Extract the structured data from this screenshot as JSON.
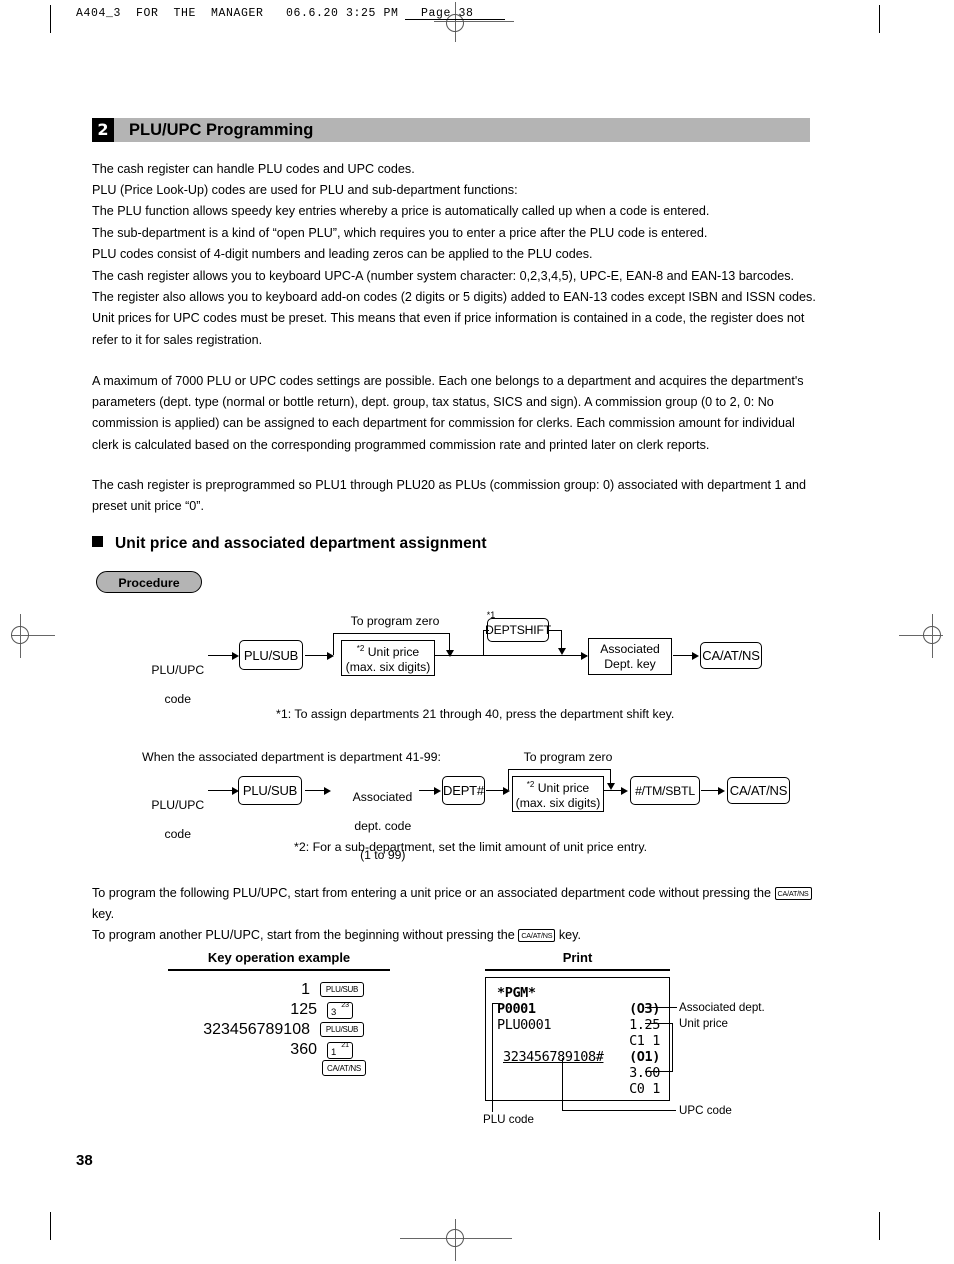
{
  "page": {
    "running_header": "A404_3  FOR  THE  MANAGER   06.6.20 3:25 PM   Page 38",
    "page_number": "38"
  },
  "section": {
    "number": "2",
    "title": "PLU/UPC Programming"
  },
  "paragraphs": {
    "p1_l1": "The cash register can handle PLU codes and UPC codes.",
    "p1_l2": "PLU (Price Look-Up) codes are used for PLU and sub-department functions:",
    "p1_l3": "The PLU function allows speedy key entries whereby a price is automatically called up when a code is entered.",
    "p1_l4": "The sub-department is a kind of “open PLU”, which requires you to enter a price after the PLU code is entered.",
    "p1_l5": "PLU codes consist of 4-digit numbers and leading zeros can be applied to the PLU codes.",
    "p2_a": "The cash register allows you to keyboard UPC-A (number system character: 0,2,3,4,5), UPC-E, EAN-8 and EAN-13 barcodes. The register also allows you to keyboard add-on codes (2 digits or 5 digits) added to EAN-13 codes except ISBN and ISSN codes.",
    "p2_b": "Unit prices for UPC codes must be preset.  This means that even if price information is contained in a code, the register does not refer to it for sales registration.",
    "p3": "A maximum of 7000 PLU or UPC codes settings are possible.  Each one belongs to a department and acquires the department's parameters (dept. type (normal or bottle return), dept. group, tax status, SICS and sign).  A commission group (0 to 2, 0: No commission is applied) can be assigned to each department for commission for clerks.  Each commission amount for individual clerk is calculated based on the corresponding programmed commission rate and printed later on clerk reports.",
    "p4": "The cash register is preprogrammed so PLU1 through PLU20 as PLUs (commission group: 0) associated with department 1 and preset unit price “0”."
  },
  "subsection": {
    "heading": "Unit price and associated department assignment",
    "procedure_label": "Procedure"
  },
  "diagram1": {
    "start_line1": "PLU/UPC",
    "start_line2": "code",
    "key_plusub": "PLU/SUB",
    "to_program_zero": "To program zero",
    "unit_price_sup": "*2",
    "unit_price_l1": "Unit price",
    "unit_price_l2": "(max. six digits)",
    "deptshift_sup": "*1",
    "key_deptshift": "DEPTSHIFT",
    "assoc_l1": "Associated",
    "assoc_l2": "Dept. key",
    "key_caatns": "CA/AT/NS",
    "footnote1": "*1: To assign departments 21 through 40, press the department shift key."
  },
  "diagram2": {
    "intro": "When the associated department is department 41-99:",
    "start_line1": "PLU/UPC",
    "start_line2": "code",
    "key_plusub": "PLU/SUB",
    "assoc_l1": "Associated",
    "assoc_l2": "dept. code",
    "assoc_l3": "(1 to 99)",
    "key_dept": "DEPT#",
    "to_program_zero": "To program zero",
    "unit_price_sup": "*2",
    "unit_price_l1": "Unit price",
    "unit_price_l2": "(max. six digits)",
    "key_tmsbtl": "#/TM/SBTL",
    "key_caatns": "CA/AT/NS",
    "footnote2": "*2: For a sub-department, set the limit amount of unit price entry."
  },
  "instructions": {
    "line1_a": "To program the following PLU/UPC, start from entering a unit price or an associated department code without pressing the ",
    "line1_key": "CA/AT/NS",
    "line1_b": " key.",
    "line2_a": "To program another PLU/UPC, start from the beginning without pressing the ",
    "line2_key": "CA/AT/NS",
    "line2_b": " key."
  },
  "example": {
    "title": "Key operation example",
    "rows": [
      {
        "value": "1",
        "key": "PLU/SUB",
        "type": "key"
      },
      {
        "value": "125",
        "key": "3",
        "sup": "23",
        "type": "num"
      },
      {
        "value": "323456789108",
        "key": "PLU/SUB",
        "type": "key"
      },
      {
        "value": "360",
        "key": "1",
        "sup": "21",
        "type": "num"
      },
      {
        "value": "",
        "key": "CA/AT/NS",
        "type": "key"
      }
    ]
  },
  "print": {
    "title": "Print",
    "receipt": {
      "l1": "*PGM*",
      "l2_left": "P0001",
      "l2_right": "(O3)",
      "l3_left": "PLU0001",
      "l3_right": "1.25",
      "l4_right": "C1 1",
      "l5_left": "323456789108#",
      "l5_right": "(O1)",
      "l6_right": "3.60",
      "l7_right": "C0 1"
    },
    "callouts": {
      "assoc_dept": "Associated dept.",
      "unit_price": "Unit price",
      "plu_code": "PLU code",
      "upc_code": "UPC code"
    }
  }
}
